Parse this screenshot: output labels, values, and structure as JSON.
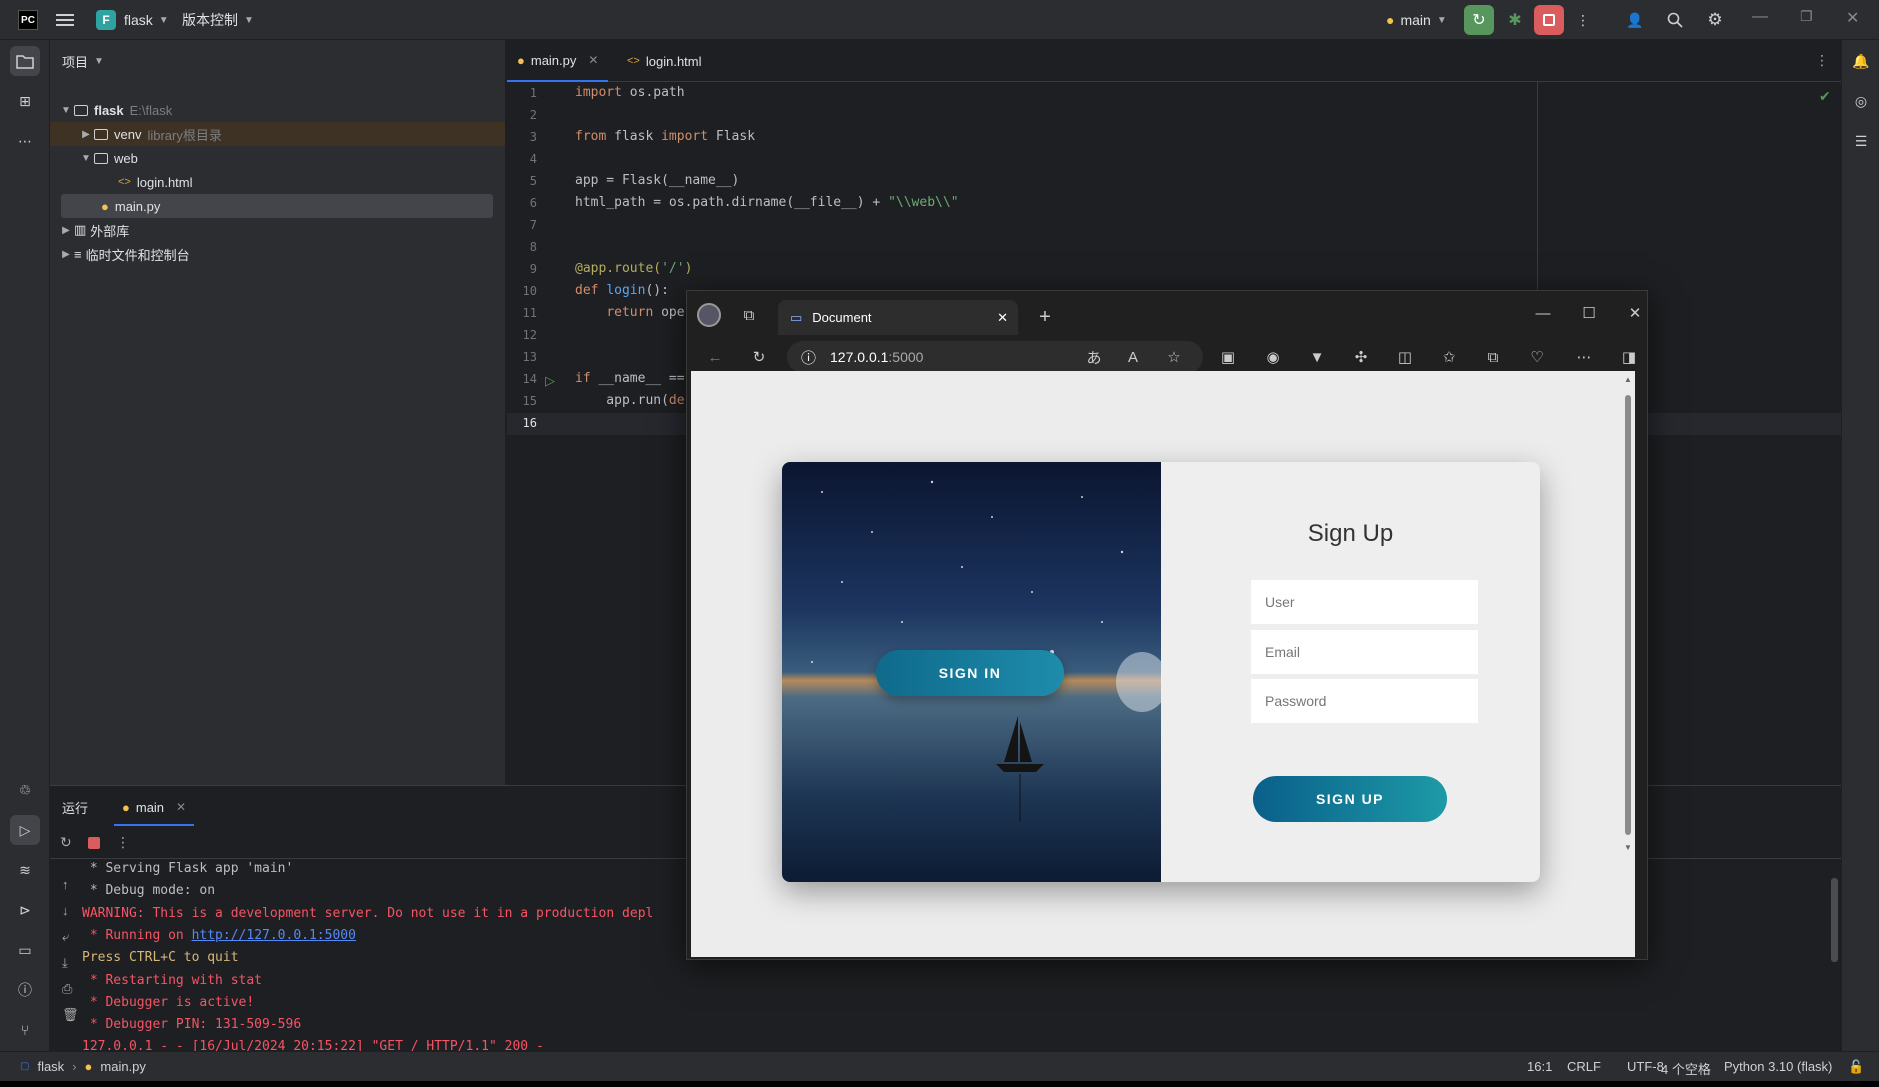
{
  "titlebar": {
    "project_letter": "F",
    "project_name": "flask",
    "vcs": "版本控制",
    "run_config": "main",
    "app_logo": "PC"
  },
  "project": {
    "title": "项目",
    "root": {
      "name": "flask",
      "path": "E:\\flask"
    },
    "venv": {
      "name": "venv",
      "hint": "library根目录"
    },
    "web": "web",
    "login": "login.html",
    "main": "main.py",
    "ext": "外部库",
    "scratch": "临时文件和控制台"
  },
  "editor": {
    "tabs": [
      "main.py",
      "login.html"
    ],
    "line_numbers": [
      "1",
      "2",
      "3",
      "4",
      "5",
      "6",
      "7",
      "8",
      "9",
      "10",
      "11",
      "12",
      "13",
      "14",
      "15",
      "16"
    ]
  },
  "run": {
    "title": "运行",
    "tab": "main",
    "lines": [
      {
        "text": " * Serving Flask app 'main'",
        "color": "#bcbec4"
      },
      {
        "text": " * Debug mode: on",
        "color": "#bcbec4"
      },
      {
        "text": "WARNING: This is a development server. Do not use it in a production depl",
        "color": "#f75464"
      },
      {
        "text": " * Running on ",
        "color": "#f75464",
        "link": "http://127.0.0.1:5000"
      },
      {
        "text": "Press CTRL+C to quit",
        "color": "#d5b778"
      },
      {
        "text": " * Restarting with stat",
        "color": "#f75464"
      },
      {
        "text": " * Debugger is active!",
        "color": "#f75464"
      },
      {
        "text": " * Debugger PIN: 131-509-596",
        "color": "#f75464"
      },
      {
        "text": "127.0.0.1 - - [16/Jul/2024 20:15:22] \"GET / HTTP/1.1\" 200 -",
        "color": "#f75464"
      }
    ]
  },
  "status": {
    "crumb_project": "flask",
    "crumb_file": "main.py",
    "position": "16:1",
    "line_sep": "CRLF",
    "encoding": "UTF-8",
    "indent": "4 个空格",
    "interpreter": "Python 3.10 (flask)"
  },
  "browser": {
    "tab_title": "Document",
    "address_host": "127.0.0.1",
    "address_port": ":5000",
    "page": {
      "heading": "Sign Up",
      "user_placeholder": "User",
      "email_placeholder": "Email",
      "password_placeholder": "Password",
      "signup_label": "SIGN UP",
      "signin_label": "SIGN IN"
    }
  },
  "colors": {
    "accent": "#3574f0",
    "run_green": "#57965c",
    "stop_red": "#db5c5c"
  }
}
